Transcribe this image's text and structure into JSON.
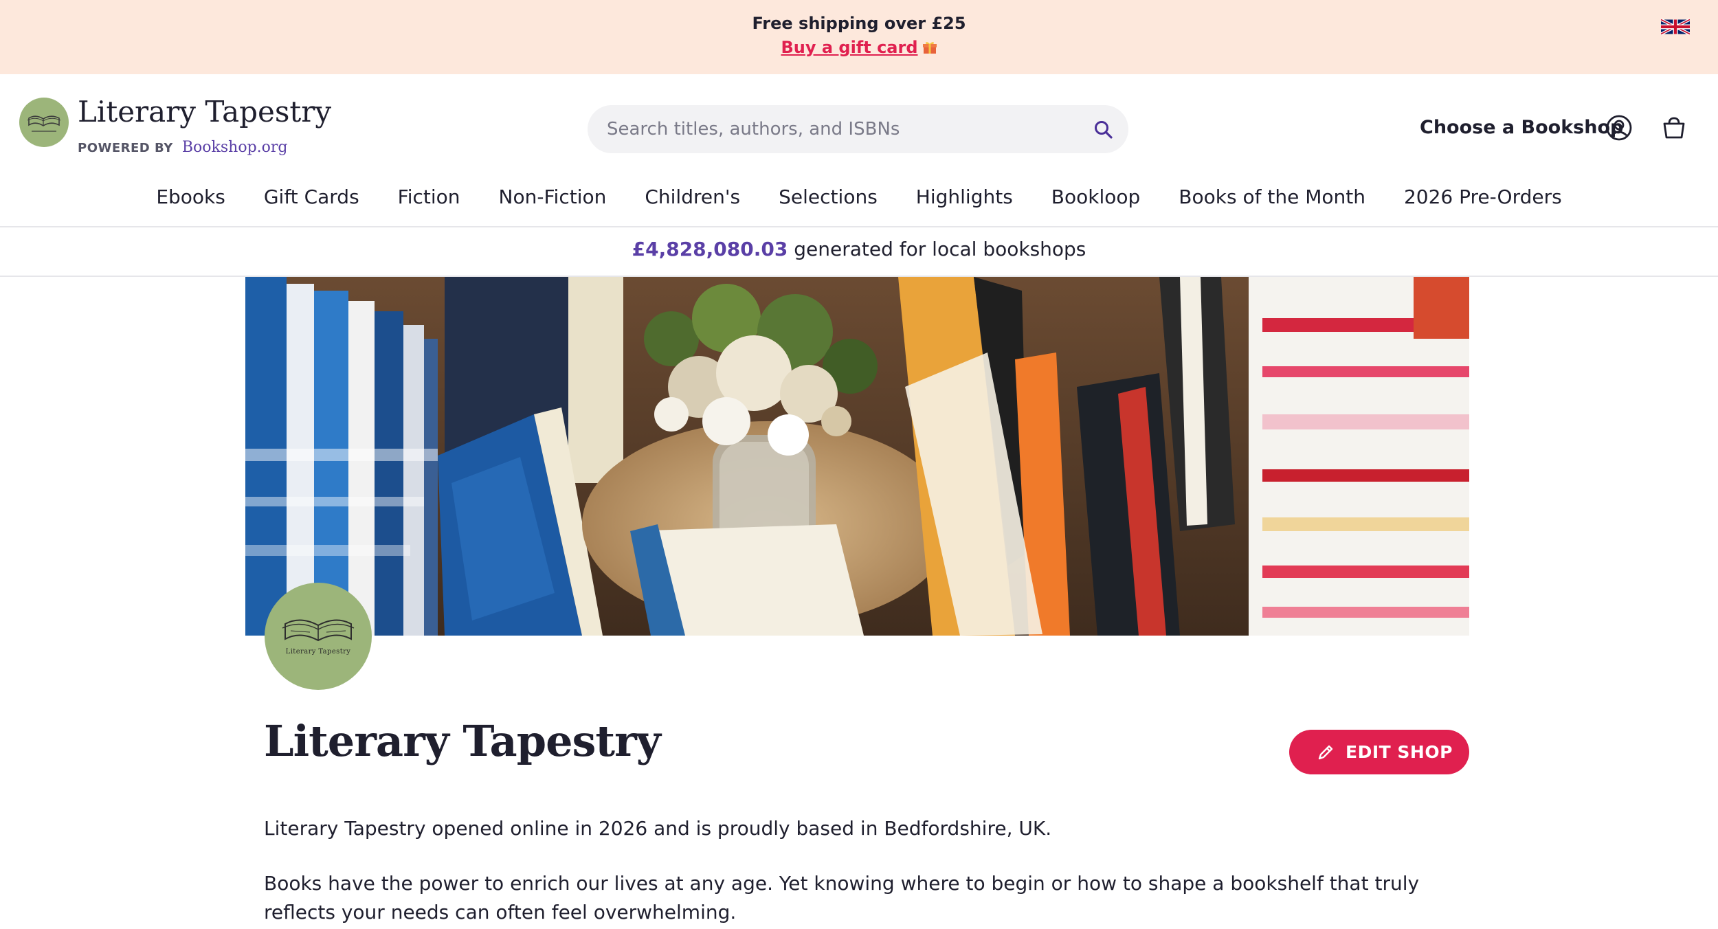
{
  "promo": {
    "shipping_text": "Free shipping over £25",
    "gift_link": "Buy a gift card",
    "gift_icon": "gift-icon",
    "flag_icon": "uk-flag-icon"
  },
  "header": {
    "logo_title": "Literary Tapestry",
    "powered_label": "POWERED BY",
    "powered_link": "Bookshop.org",
    "logo_badge_text": "Literary Tapestry",
    "search_placeholder": "Search titles, authors, and ISBNs",
    "search_value": "",
    "choose_bookshop": "Choose a Bookshop",
    "icons": [
      "search-icon",
      "account-icon",
      "shopping-bag-icon"
    ]
  },
  "nav": {
    "items": [
      "Ebooks",
      "Gift Cards",
      "Fiction",
      "Non-Fiction",
      "Children's",
      "Selections",
      "Highlights",
      "Bookloop",
      "Books of the Month",
      "2026 Pre-Orders"
    ]
  },
  "stat": {
    "amount": "£4,828,080.03",
    "text": "generated for local bookshops"
  },
  "shop": {
    "badge_text": "Literary Tapestry",
    "title": "Literary Tapestry",
    "edit_button": "EDIT SHOP",
    "edit_icon": "pencil-icon",
    "description_1": "Literary Tapestry opened online in 2026 and is proudly based in Bedfordshire, UK.",
    "description_2": "Books have the power to enrich our lives at any age. Yet knowing where to begin or how to shape a bookshelf that truly reflects your needs can often feel overwhelming."
  },
  "colors": {
    "promo_bg": "#fde8dc",
    "accent_pink": "#e0204f",
    "brand_purple": "#5a3fa6",
    "logo_green": "#9cb57a"
  }
}
